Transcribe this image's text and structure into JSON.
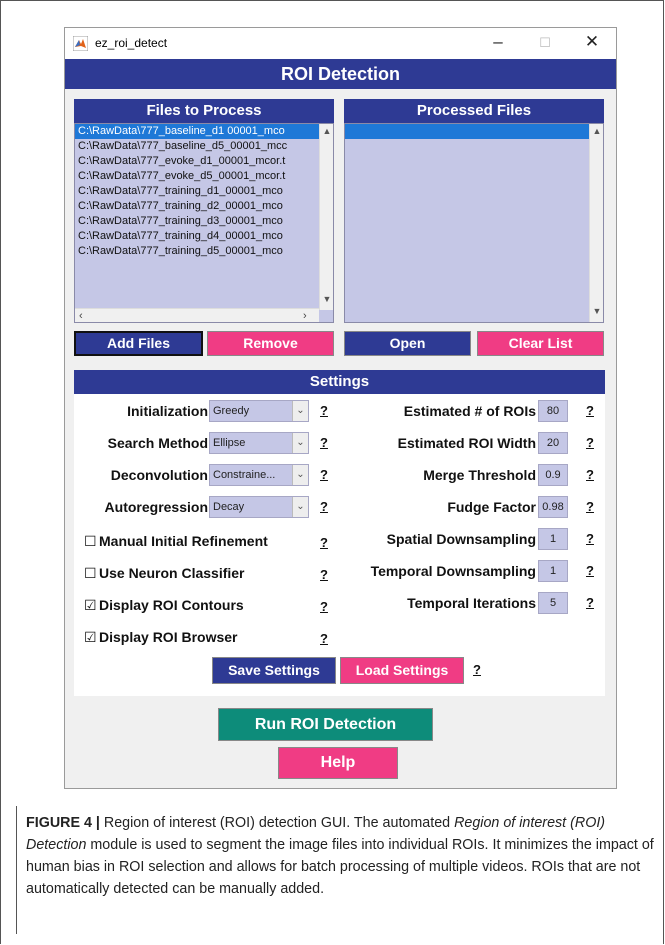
{
  "window": {
    "app_title": "ez_roi_detect",
    "min_glyph": "–",
    "max_glyph": "☐",
    "close_glyph": "✕",
    "main_title": "ROI Detection"
  },
  "files_panel": {
    "title": "Files to Process",
    "items": [
      "C:\\RawData\\777_baseline_d1 00001_mco",
      "C:\\RawData\\777_baseline_d5_00001_mcc",
      "C:\\RawData\\777_evoke_d1_00001_mcor.t",
      "C:\\RawData\\777_evoke_d5_00001_mcor.t",
      "C:\\RawData\\777_training_d1_00001_mco",
      "C:\\RawData\\777_training_d2_00001_mco",
      "C:\\RawData\\777_training_d3_00001_mco",
      "C:\\RawData\\777_training_d4_00001_mco",
      "C:\\RawData\\777_training_d5_00001_mco"
    ],
    "add_label": "Add Files",
    "remove_label": "Remove"
  },
  "processed_panel": {
    "title": "Processed Files",
    "open_label": "Open",
    "clear_label": "Clear List"
  },
  "settings": {
    "title": "Settings",
    "help_glyph": "?",
    "left_dropdowns": [
      {
        "label": "Initialization",
        "value": "Greedy"
      },
      {
        "label": "Search Method",
        "value": "Ellipse"
      },
      {
        "label": "Deconvolution",
        "value": "Constraine..."
      },
      {
        "label": "Autoregression",
        "value": "Decay"
      }
    ],
    "checkboxes": [
      {
        "label": "Manual Initial Refinement",
        "checked_glyph": "☐"
      },
      {
        "label": "Use Neuron Classifier",
        "checked_glyph": "☐"
      },
      {
        "label": "Display ROI Contours",
        "checked_glyph": "☑"
      },
      {
        "label": "Display ROI Browser",
        "checked_glyph": "☑"
      }
    ],
    "right_fields": [
      {
        "label": "Estimated # of ROIs",
        "value": "80"
      },
      {
        "label": "Estimated ROI Width",
        "value": "20"
      },
      {
        "label": "Merge Threshold",
        "value": "0.9"
      },
      {
        "label": "Fudge Factor",
        "value": "0.98"
      },
      {
        "label": "Spatial Downsampling",
        "value": "1"
      },
      {
        "label": "Temporal Downsampling",
        "value": "1"
      },
      {
        "label": "Temporal Iterations",
        "value": "5"
      }
    ],
    "save_label": "Save Settings",
    "load_label": "Load Settings"
  },
  "actions": {
    "run_label": "Run ROI Detection",
    "help_label": "Help"
  },
  "caption": {
    "fig_label": "FIGURE 4 | ",
    "text1": "Region of interest (ROI) detection GUI. The automated ",
    "ital": "Region of interest (ROI) Detection",
    "text2": " module is used to segment the image files into individual ROIs. It minimizes the impact of human bias in ROI selection and allows for batch processing of multiple videos. ROIs that are not automatically detected can be manually added."
  },
  "colors": {
    "header_blue": "#2e3a94",
    "button_pink": "#f03c84",
    "button_teal": "#0d8c7a",
    "field_lavender": "#c5c7e6",
    "selection_blue": "#1e78d7"
  }
}
